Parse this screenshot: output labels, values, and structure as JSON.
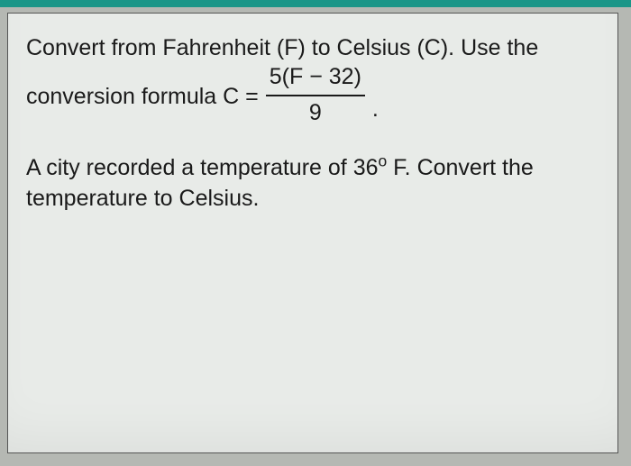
{
  "problem": {
    "line1": "Convert from Fahrenheit (F) to Celsius (C). Use the",
    "formula_prefix": "conversion formula C =",
    "fraction": {
      "numerator": "5(F − 32)",
      "denominator": "9"
    },
    "period": ".",
    "para2_part1": "A city recorded a temperature of ",
    "temp_value": "36",
    "degree_symbol": "o",
    "temp_unit": " F. Convert the",
    "para2_line2": "temperature to Celsius."
  }
}
